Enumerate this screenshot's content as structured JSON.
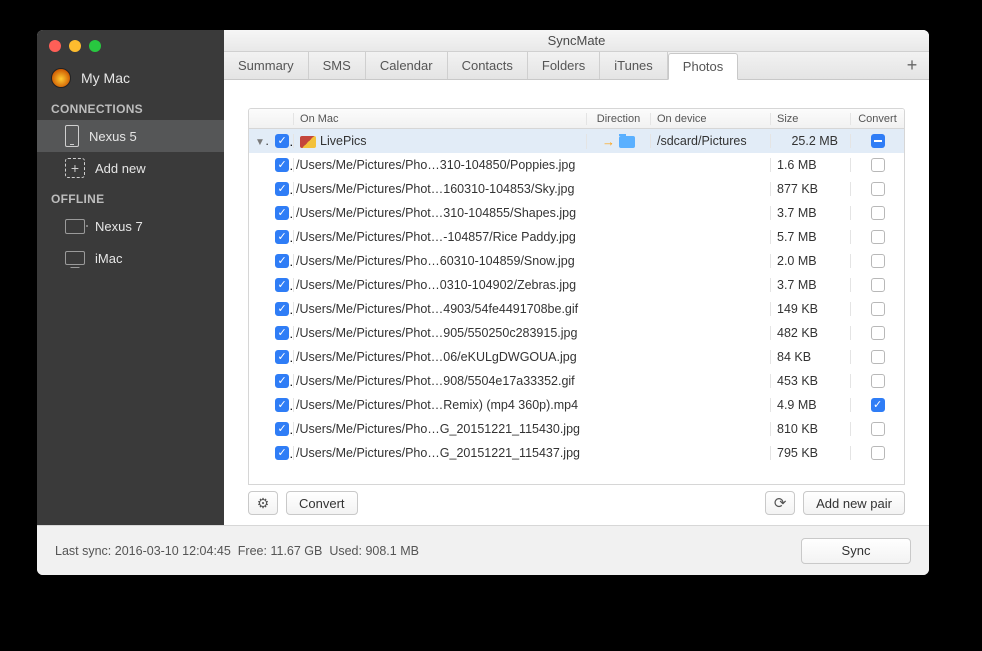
{
  "window_title": "SyncMate",
  "sidebar": {
    "my_mac": "My Mac",
    "section_connections": "CONNECTIONS",
    "section_offline": "OFFLINE",
    "add_new": "Add new",
    "devices": [
      {
        "name": "Nexus 5",
        "icon": "phone",
        "selected": true,
        "section": "connections"
      },
      {
        "name": "Nexus 7",
        "icon": "tablet",
        "selected": false,
        "section": "offline"
      },
      {
        "name": "iMac",
        "icon": "imac",
        "selected": false,
        "section": "offline"
      }
    ]
  },
  "tabs": [
    "Summary",
    "SMS",
    "Calendar",
    "Contacts",
    "Folders",
    "iTunes",
    "Photos"
  ],
  "active_tab": "Photos",
  "columns": {
    "mac": "On Mac",
    "dir": "Direction",
    "dev": "On device",
    "size": "Size",
    "conv": "Convert"
  },
  "groups": [
    {
      "mac": "LivePics",
      "dev": "/sdcard/Pictures",
      "size": "25.2 MB",
      "expanded": true,
      "checked": true,
      "convert": "mixed",
      "items": [
        {
          "mac": "/Users/Me/Pictures/Pho…310-104850/Poppies.jpg",
          "size": "1.6 MB",
          "checked": true,
          "convert": false
        },
        {
          "mac": "/Users/Me/Pictures/Phot…160310-104853/Sky.jpg",
          "size": "877 KB",
          "checked": true,
          "convert": false
        },
        {
          "mac": "/Users/Me/Pictures/Phot…310-104855/Shapes.jpg",
          "size": "3.7 MB",
          "checked": true,
          "convert": false
        },
        {
          "mac": "/Users/Me/Pictures/Phot…-104857/Rice Paddy.jpg",
          "size": "5.7 MB",
          "checked": true,
          "convert": false
        },
        {
          "mac": "/Users/Me/Pictures/Pho…60310-104859/Snow.jpg",
          "size": "2.0 MB",
          "checked": true,
          "convert": false
        },
        {
          "mac": "/Users/Me/Pictures/Pho…0310-104902/Zebras.jpg",
          "size": "3.7 MB",
          "checked": true,
          "convert": false
        },
        {
          "mac": "/Users/Me/Pictures/Phot…4903/54fe4491708be.gif",
          "size": "149 KB",
          "checked": true,
          "convert": false
        },
        {
          "mac": "/Users/Me/Pictures/Phot…905/550250c283915.jpg",
          "size": "482 KB",
          "checked": true,
          "convert": false
        },
        {
          "mac": "/Users/Me/Pictures/Phot…06/eKULgDWGOUA.jpg",
          "size": "84 KB",
          "checked": true,
          "convert": false
        },
        {
          "mac": "/Users/Me/Pictures/Phot…908/5504e17a33352.gif",
          "size": "453 KB",
          "checked": true,
          "convert": false
        },
        {
          "mac": "/Users/Me/Pictures/Phot…Remix) (mp4 360p).mp4",
          "size": "4.9 MB",
          "checked": true,
          "convert": true
        },
        {
          "mac": "/Users/Me/Pictures/Pho…G_20151221_115430.jpg",
          "size": "810 KB",
          "checked": true,
          "convert": false
        },
        {
          "mac": "/Users/Me/Pictures/Pho…G_20151221_115437.jpg",
          "size": "795 KB",
          "checked": true,
          "convert": false
        }
      ]
    }
  ],
  "toolbar": {
    "convert": "Convert",
    "add_pair": "Add new pair"
  },
  "footer": {
    "last_sync_label": "Last sync:",
    "last_sync": "2016-03-10 12:04:45",
    "free_label": "Free:",
    "free": "11.67 GB",
    "used_label": "Used:",
    "used": "908.1 MB",
    "sync": "Sync"
  }
}
